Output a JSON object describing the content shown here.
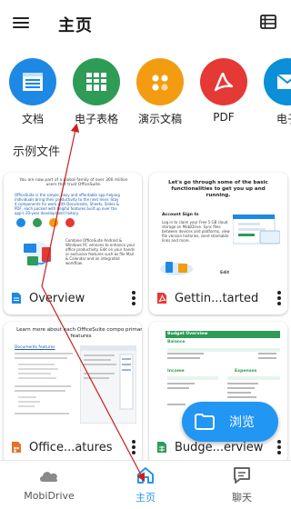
{
  "header": {
    "title": "主页",
    "menu_icon": "hamburger-menu-icon",
    "view_icon": "list-view-icon"
  },
  "categories": [
    {
      "label": "文档",
      "color": "#1e88e5",
      "icon": "document-icon"
    },
    {
      "label": "电子表格",
      "color": "#2e9b57",
      "icon": "spreadsheet-icon"
    },
    {
      "label": "演示文稿",
      "color": "#f39c12",
      "icon": "presentation-icon"
    },
    {
      "label": "PDF",
      "color": "#e53935",
      "icon": "pdf-icon"
    },
    {
      "label": "电子",
      "color": "#0b8fd6",
      "icon": "email-icon"
    }
  ],
  "section_title": "示例文件",
  "files": [
    {
      "name": "Overview",
      "type": "doc",
      "color": "#1e88e5",
      "preview": {
        "intro": "You are now part of a global family of over 300 million users that trust OfficeSuite.",
        "body": "OfficeSuite is the simple, easy and affordable app helping individuals bring their productivity to the next level. Stay 4 components for work with Documents, Sheets, Slides & PDF, each packed with helpful features built up over the app's 20-year development history.",
        "combine": "Combine OfficeSuite Android & Windows PC versions to enhance your office productivity. Edit on your hands or exclusive features such as file Mail & Calendar and an integrated workflow.",
        "icons": [
          "100% Compatible",
          "Feature Rich",
          "Secure",
          "Easy Work"
        ]
      }
    },
    {
      "name": "Gettin...tarted",
      "type": "pdf",
      "color": "#e53935",
      "preview": {
        "heading": "Let's go through some of the basic functionalities to get you up and running.",
        "subheading": "Account Sign In",
        "body": "Log in to claim your Free 5 GB cloud storage on MobiDrive. Sync files between devices and platforms, view file version histories, send shareable links and more.",
        "edit_label": "Edit"
      }
    },
    {
      "name": "Office...atures",
      "type": "presentation",
      "color": "#f39c12",
      "preview": {
        "heading": "Learn more about each OfficeSuite compo primary features",
        "subheading": "Documents features"
      }
    },
    {
      "name": "Budge...erview",
      "type": "sheet",
      "color": "#2e9b57",
      "preview": {
        "title": "Budget Overview",
        "balance_label": "Balance",
        "income_label": "Income",
        "expenses_label": "Expenses"
      }
    }
  ],
  "fab": {
    "label": "浏览",
    "icon": "folder-icon"
  },
  "bottom_nav": [
    {
      "label": "MobiDrive",
      "icon": "cloud-icon",
      "active": false
    },
    {
      "label": "主页",
      "icon": "home-icon",
      "active": true
    },
    {
      "label": "聊天",
      "icon": "chat-icon",
      "active": false
    }
  ],
  "colors": {
    "accent": "#2196f3",
    "annotation": "#cc1f1f"
  }
}
